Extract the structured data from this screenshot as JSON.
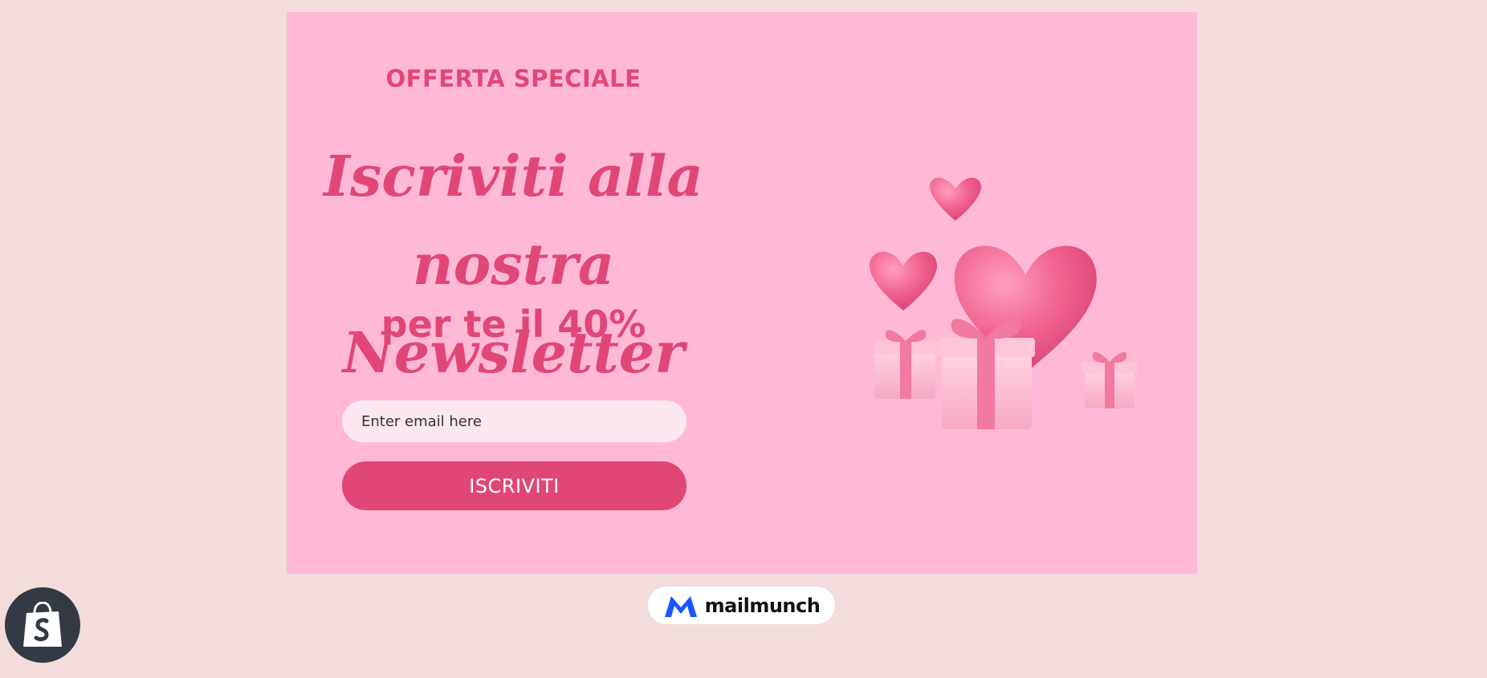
{
  "popup": {
    "eyebrow": "OFFERTA SPECIALE",
    "headline_line1": "Iscriviti alla",
    "headline_line2": "nostra Newsletter",
    "subhead": "per te il 40%",
    "email_placeholder": "Enter email here",
    "submit_label": "ISCRIVITI",
    "illustration": "hearts-and-gifts-illustration"
  },
  "footer": {
    "powered_by_brand": "mailmunch",
    "powered_by_icon": "mailmunch-logo-icon",
    "store_icon": "shopify-bag-icon"
  },
  "colors": {
    "page_background": "#f2dcdc",
    "popup_background": "#ffb9d6",
    "accent": "#e04777",
    "input_background": "#fde7f0",
    "mailmunch_blue": "#1a56ff",
    "shopify_dark": "#343a43"
  }
}
